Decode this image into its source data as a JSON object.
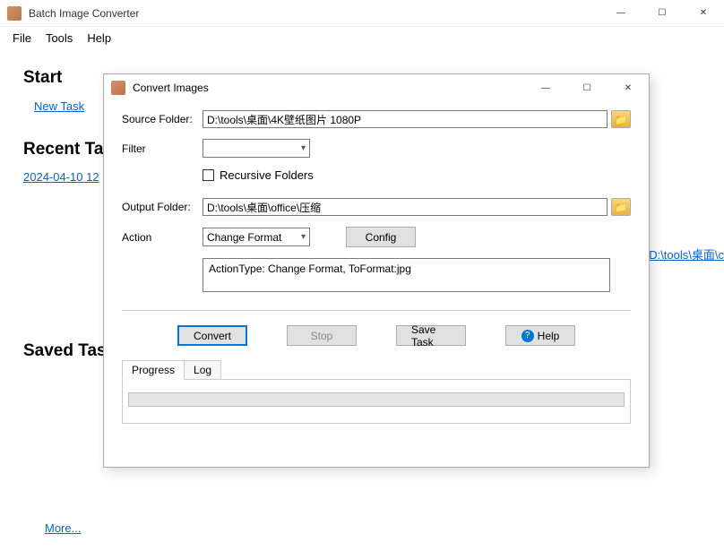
{
  "window": {
    "title": "Batch Image Converter",
    "minimize": "—",
    "maximize": "☐",
    "close": "✕"
  },
  "menu": {
    "file": "File",
    "tools": "Tools",
    "help": "Help"
  },
  "start": {
    "heading": "Start",
    "new_task": "New Task"
  },
  "recent": {
    "heading": "Recent Tasks",
    "item_date": "2024-04-10 12",
    "item_to": "To : D:\\tools\\桌面\\c"
  },
  "saved": {
    "heading": "Saved Tasks",
    "more": "More..."
  },
  "dialog": {
    "title": "Convert Images",
    "minimize": "—",
    "maximize": "☐",
    "close": "✕",
    "source_folder_label": "Source Folder:",
    "source_folder_value": "D:\\tools\\桌面\\4K壁纸图片 1080P",
    "filter_label": "Filter",
    "filter_value": "",
    "recursive_label": "Recursive Folders",
    "output_folder_label": "Output Folder:",
    "output_folder_value": "D:\\tools\\桌面\\office\\压缩",
    "action_label": "Action",
    "action_value": "Change Format",
    "config_btn": "Config",
    "action_info": "ActionType: Change Format, ToFormat:jpg",
    "convert_btn": "Convert",
    "stop_btn": "Stop",
    "save_task_btn": "Save Task",
    "help_btn": "Help",
    "tab_progress": "Progress",
    "tab_log": "Log"
  }
}
